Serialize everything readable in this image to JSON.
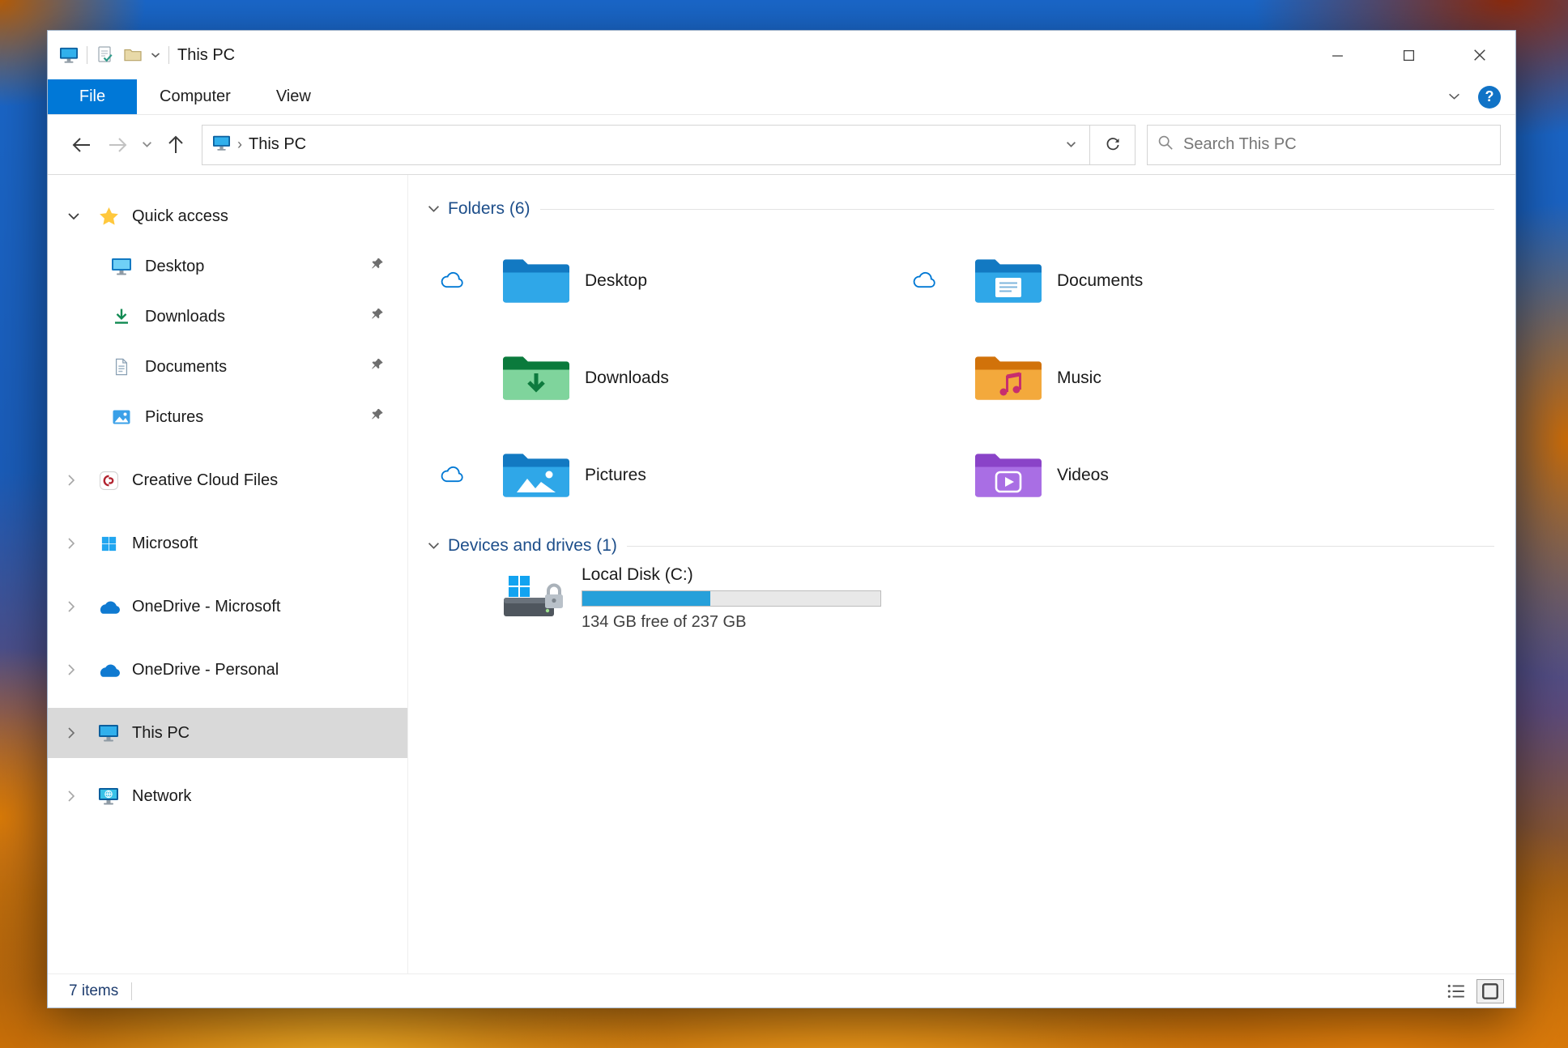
{
  "titlebar": {
    "title": "This PC"
  },
  "ribbon": {
    "tabs": [
      {
        "label": "File",
        "active": true
      },
      {
        "label": "Computer",
        "active": false
      },
      {
        "label": "View",
        "active": false
      }
    ],
    "help_label": "?"
  },
  "navbar": {
    "breadcrumb": "This PC",
    "breadcrumb_separator": "›",
    "search_placeholder": "Search This PC"
  },
  "sidebar": {
    "items": [
      {
        "label": "Quick access",
        "expanded": true
      },
      {
        "label": "Desktop",
        "pinned": true
      },
      {
        "label": "Downloads",
        "pinned": true
      },
      {
        "label": "Documents",
        "pinned": true
      },
      {
        "label": "Pictures",
        "pinned": true
      },
      {
        "label": "Creative Cloud Files"
      },
      {
        "label": "Microsoft"
      },
      {
        "label": "OneDrive - Microsoft"
      },
      {
        "label": "OneDrive - Personal"
      },
      {
        "label": "This PC",
        "selected": true
      },
      {
        "label": "Network"
      }
    ]
  },
  "content": {
    "folders_header": "Folders (6)",
    "devices_header": "Devices and drives (1)",
    "folders": [
      {
        "label": "Desktop",
        "cloud_synced": true
      },
      {
        "label": "Documents",
        "cloud_synced": true
      },
      {
        "label": "Downloads",
        "cloud_synced": false
      },
      {
        "label": "Music",
        "cloud_synced": false
      },
      {
        "label": "Pictures",
        "cloud_synced": true
      },
      {
        "label": "Videos",
        "cloud_synced": false
      }
    ],
    "drive": {
      "label": "Local Disk (C:)",
      "free_text": "134 GB free of 237 GB",
      "used_percent": 43
    }
  },
  "statusbar": {
    "items_count": "7 items"
  },
  "colors": {
    "accent": "#0078d7",
    "progress_fill": "#26a0da",
    "selection_gray": "#d9d9d9",
    "group_header_blue": "#1d4e8a"
  }
}
